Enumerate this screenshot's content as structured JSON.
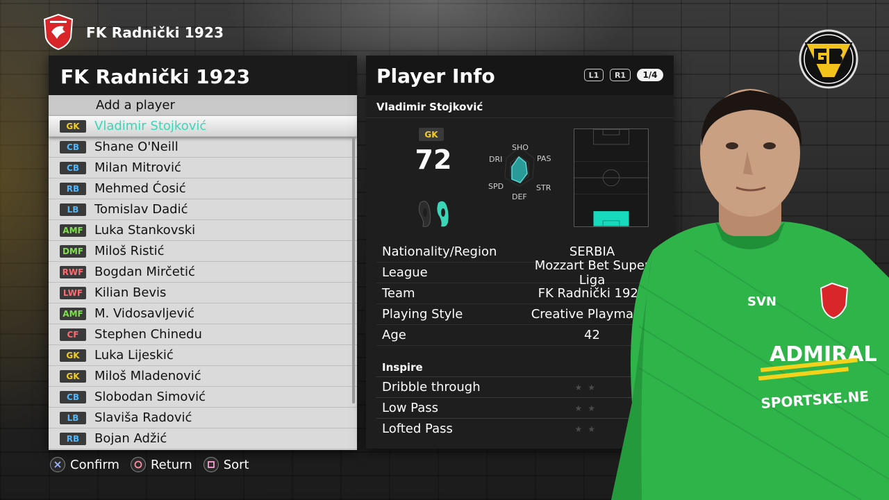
{
  "header": {
    "team_name": "FK Radnički 1923"
  },
  "squad": {
    "title": "FK Radnički 1923",
    "add_label": "Add a player",
    "players": [
      {
        "pos": "GK",
        "name": "Vladimir Stojković",
        "group": "gk",
        "selected": true
      },
      {
        "pos": "CB",
        "name": "Shane O'Neill",
        "group": "def"
      },
      {
        "pos": "CB",
        "name": "Milan Mitrović",
        "group": "def"
      },
      {
        "pos": "RB",
        "name": "Mehmed Ćosić",
        "group": "def"
      },
      {
        "pos": "LB",
        "name": "Tomislav Dadić",
        "group": "def"
      },
      {
        "pos": "AMF",
        "name": "Luka Stankovski",
        "group": "mid"
      },
      {
        "pos": "DMF",
        "name": "Miloš Ristić",
        "group": "mid"
      },
      {
        "pos": "RWF",
        "name": "Bogdan Mirčetić",
        "group": "fwd"
      },
      {
        "pos": "LWF",
        "name": "Kilian Bevis",
        "group": "fwd"
      },
      {
        "pos": "AMF",
        "name": "M. Vidosavljević",
        "group": "mid"
      },
      {
        "pos": "CF",
        "name": "Stephen Chinedu",
        "group": "fwd"
      },
      {
        "pos": "GK",
        "name": "Luka Lijeskić",
        "group": "gk"
      },
      {
        "pos": "GK",
        "name": "Miloš Mladenović",
        "group": "gk"
      },
      {
        "pos": "CB",
        "name": "Slobodan Simović",
        "group": "def"
      },
      {
        "pos": "LB",
        "name": "Slaviša Radović",
        "group": "def"
      },
      {
        "pos": "RB",
        "name": "Bojan Adžić",
        "group": "def"
      }
    ]
  },
  "player_info": {
    "title": "Player Info",
    "l1": "L1",
    "r1": "R1",
    "page": "1/4",
    "name": "Vladimir Stojković",
    "position": "GK",
    "overall": "72",
    "radar_labels": {
      "sho": "SHO",
      "pas": "PAS",
      "str": "STR",
      "def": "DEF",
      "spd": "SPD",
      "dri": "DRI"
    },
    "attributes": [
      {
        "key": "Nationality/Region",
        "value": "SERBIA"
      },
      {
        "key": "League",
        "value": "Mozzart Bet Super Liga"
      },
      {
        "key": "Team",
        "value": "FK Radnički 1923"
      },
      {
        "key": "Playing Style",
        "value": "Creative Playmaker"
      },
      {
        "key": "Age",
        "value": "42"
      }
    ],
    "inspire_title": "Inspire",
    "inspire": [
      {
        "label": "Dribble through",
        "stars": "★★"
      },
      {
        "label": "Low Pass",
        "stars": "★★"
      },
      {
        "label": "Lofted Pass",
        "stars": "★★"
      }
    ]
  },
  "footer": {
    "confirm": "Confirm",
    "return": "Return",
    "sort": "Sort"
  },
  "colors": {
    "accent_teal": "#3ad6b7",
    "gk": "#f4cd1f",
    "defender": "#4fb8ff",
    "midfielder": "#7ee24a",
    "forward": "#ff6a72",
    "kit_green": "#2fb44a"
  }
}
